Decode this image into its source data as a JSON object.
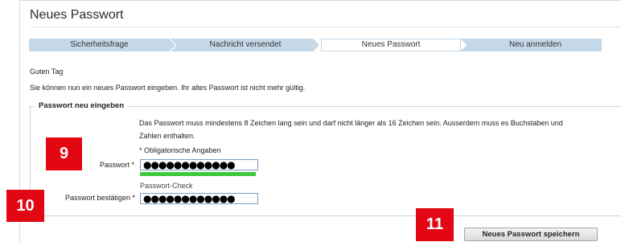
{
  "header": {
    "title": "Neues Passwort"
  },
  "steps": [
    {
      "label": "Sicherheitsfrage"
    },
    {
      "label": "Nachricht versendet"
    },
    {
      "label": "Neues Passwort"
    },
    {
      "label": "Neu anmelden"
    }
  ],
  "intro": {
    "greeting": "Guten Tag",
    "message": "Sie können nun ein neues Passwort eingeben. Ihr altes Passwort ist nicht mehr gültig."
  },
  "form": {
    "legend": "Passwort neu eingeben",
    "requirements_line1": "Das Passwort muss mindestens 8 Zeichen lang sein und darf nicht länger als 16 Zeichen sein. Ausserdem muss es Buchstaben und",
    "requirements_line2": "Zahlen enthalten.",
    "mandatory_note": "* Obligatorische Angaben",
    "password_label": "Passwort *",
    "password_value": "●●●●●●●●●●●●",
    "password_check_label": "Passwort-Check",
    "password_strength": 1.0,
    "confirm_label": "Passwort bestätigen *",
    "confirm_value": "●●●●●●●●●●●●",
    "save_label": "Neues Passwort speichern"
  },
  "annotations": {
    "badge_9": "9",
    "badge_10": "10",
    "badge_11": "11"
  },
  "colors": {
    "accent_step": "#c5d8e8",
    "badge": "#e30613",
    "strength": "#3ec83e",
    "input_border": "#7a9cc0"
  }
}
